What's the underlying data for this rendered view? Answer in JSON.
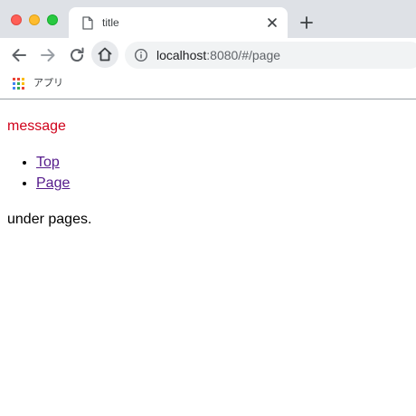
{
  "browser": {
    "tab": {
      "title": "title"
    },
    "address_bar": {
      "host": "localhost",
      "rest": ":8080/#/page"
    },
    "bookmarks": {
      "apps_label": "アプリ"
    }
  },
  "page": {
    "message": "message",
    "links": [
      {
        "label": "Top"
      },
      {
        "label": "Page"
      }
    ],
    "footer_text": "under pages."
  },
  "colors": {
    "message": "#d0021b",
    "link": "#551a8b",
    "tabstrip": "#dee1e6"
  }
}
